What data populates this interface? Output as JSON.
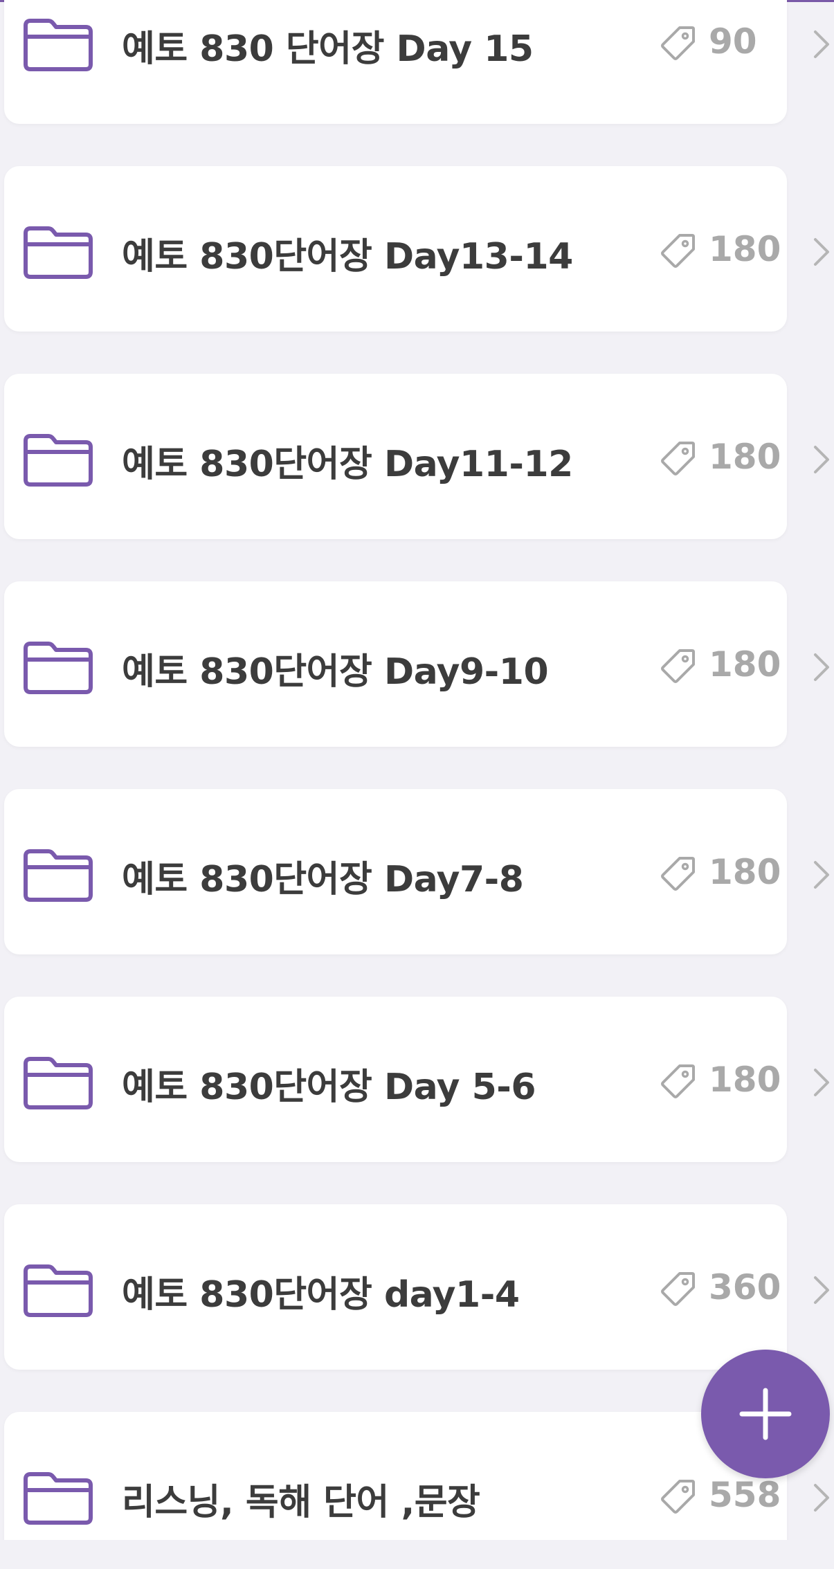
{
  "colors": {
    "accent": "#7a5aad",
    "title_text": "#3c3c3c",
    "count_text": "#a9a9a9",
    "background": "#f2f1f6",
    "card": "#ffffff"
  },
  "folders": [
    {
      "title": "예토 830 단어장 Day 15",
      "count": "90",
      "icon": "folder-icon",
      "tag_icon": "tag-icon"
    },
    {
      "title": "예토 830단어장 Day13-14",
      "count": "180",
      "icon": "folder-icon",
      "tag_icon": "tag-icon"
    },
    {
      "title": "예토 830단어장 Day11-12",
      "count": "180",
      "icon": "folder-icon",
      "tag_icon": "tag-icon"
    },
    {
      "title": "예토 830단어장 Day9-10",
      "count": "180",
      "icon": "folder-icon",
      "tag_icon": "tag-icon"
    },
    {
      "title": "예토 830단어장 Day7-8",
      "count": "180",
      "icon": "folder-icon",
      "tag_icon": "tag-icon"
    },
    {
      "title": "예토 830단어장 Day 5-6",
      "count": "180",
      "icon": "folder-icon",
      "tag_icon": "tag-icon"
    },
    {
      "title": "예토 830단어장 day1-4",
      "count": "360",
      "icon": "folder-icon",
      "tag_icon": "tag-icon"
    },
    {
      "title": "리스닝, 독해 단어 ,문장",
      "count": "558",
      "icon": "folder-icon",
      "tag_icon": "tag-icon"
    }
  ],
  "fab": {
    "icon": "plus-icon"
  }
}
